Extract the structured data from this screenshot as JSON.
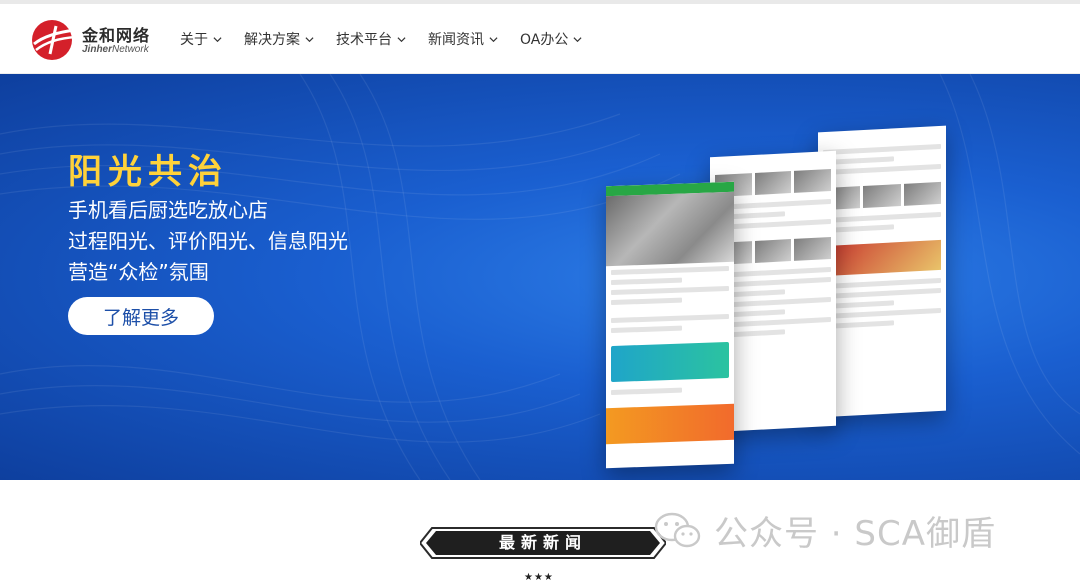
{
  "brand": {
    "name_cn": "金和网络",
    "name_en_bold": "Jinher",
    "name_en_light": "Network",
    "colors": {
      "logo_red": "#d4202a",
      "nav_text": "#333333",
      "banner_blue": "#1a5fd0",
      "hero_title": "#ffd23a",
      "button_text": "#1d4fa8"
    }
  },
  "nav": {
    "items": [
      {
        "label": "关于"
      },
      {
        "label": "解决方案"
      },
      {
        "label": "技术平台"
      },
      {
        "label": "新闻资讯"
      },
      {
        "label": "OA办公"
      }
    ]
  },
  "hero": {
    "title": "阳光共治",
    "line1": "手机看后厨选吃放心店",
    "line2": "过程阳光、评价阳光、信息阳光",
    "line3": "营造“众检”氛围",
    "button_label": "了解更多"
  },
  "carousel": {
    "slide_count": 4,
    "active_index": 0,
    "prev_icon": "chevron-left-icon",
    "next_icon": "chevron-right-icon"
  },
  "news": {
    "title": "最新新闻",
    "stars": "★★★"
  },
  "watermark": {
    "text": "公众号 · SCA御盾",
    "icon": "wechat-icon"
  }
}
